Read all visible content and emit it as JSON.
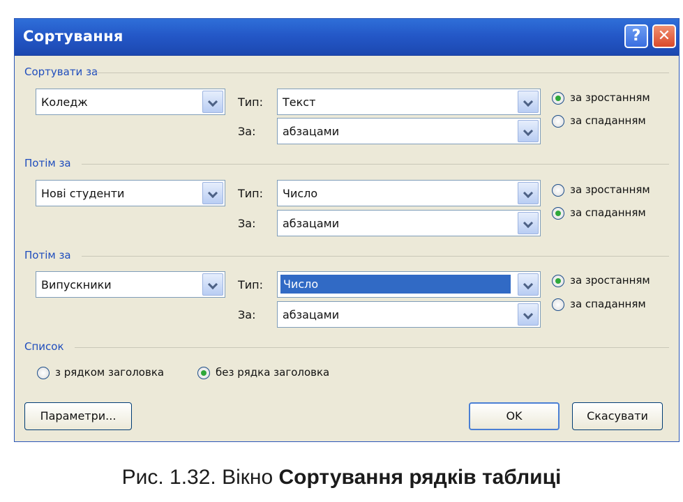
{
  "window": {
    "title": "Сортування",
    "help_label": "?",
    "close_label": "✕",
    "help_icon": "question-icon",
    "close_icon": "close-icon"
  },
  "groups": [
    {
      "label": "Сортувати за",
      "field": "Коледж",
      "type_label": "Тип:",
      "type_value": "Текст",
      "by_label": "За:",
      "by_value": "абзацами",
      "asc_label": "за зростанням",
      "desc_label": "за спаданням",
      "order": "asc"
    },
    {
      "label": "Потім за",
      "field": "Нові студенти",
      "type_label": "Тип:",
      "type_value": "Число",
      "by_label": "За:",
      "by_value": "абзацами",
      "asc_label": "за зростанням",
      "desc_label": "за спаданням",
      "order": "desc"
    },
    {
      "label": "Потім за",
      "field": "Випускники",
      "type_label": "Тип:",
      "type_value": "Число",
      "by_label": "За:",
      "by_value": "абзацами",
      "asc_label": "за зростанням",
      "desc_label": "за спаданням",
      "order": "asc"
    }
  ],
  "list": {
    "label": "Список",
    "with_header": "з рядком заголовка",
    "without_header": "без рядка заголовка",
    "selected": "without_header"
  },
  "buttons": {
    "params": "Параметри...",
    "ok": "OK",
    "cancel": "Скасувати"
  },
  "caption": {
    "prefix": "Рис. 1.32. Вікно ",
    "bold": "Сортування рядків таблиці"
  },
  "colors": {
    "title_bar": "#2458c8",
    "group_label": "#1f4dbd",
    "selection": "#316ac5",
    "radio_on": "#2fa83a",
    "close_button": "#d9492a"
  }
}
